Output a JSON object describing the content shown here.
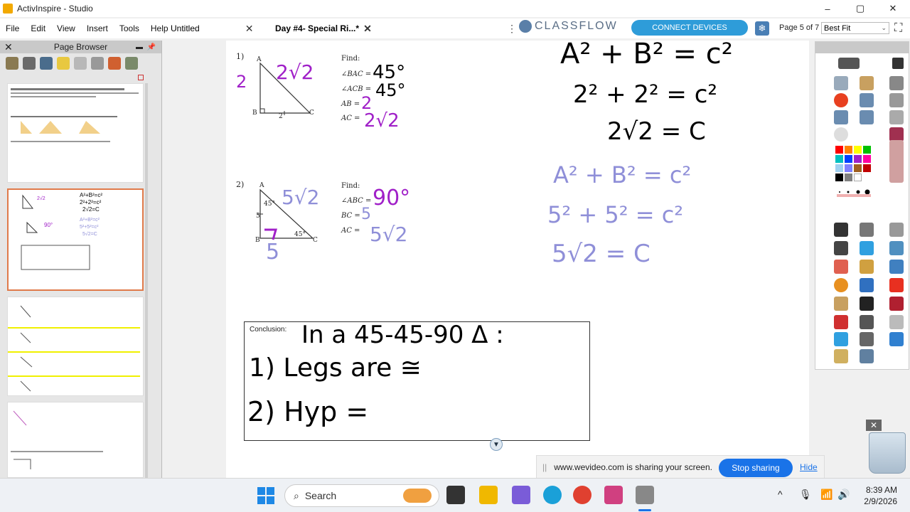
{
  "window": {
    "title": "ActivInspire - Studio",
    "minimize": "‒",
    "maximize": "▢",
    "close": "✕"
  },
  "menu": [
    "File",
    "Edit",
    "View",
    "Insert",
    "Tools",
    "Help"
  ],
  "tabs": [
    {
      "label": "Untitled",
      "close": "✕"
    },
    {
      "label": "Day #4- Special Ri...*",
      "close": "✕"
    }
  ],
  "toolbar": {
    "more": "⋮",
    "classflow": "CLASSFLOW",
    "connect_devices": "CONNECT DEVICES",
    "page_indicator": "Page 5 of 7",
    "zoom": "Best Fit",
    "zoom_arrow": "⌄",
    "expand": "⛶",
    "snowflake": "❄"
  },
  "page_browser": {
    "title": "Page Browser",
    "close": "✕",
    "pin": "▬",
    "pin2": "📌"
  },
  "problem1": {
    "number": "1)",
    "vertex_a": "A",
    "vertex_b": "B",
    "vertex_c": "C",
    "leg_bottom": "2",
    "handwritten_side": "2",
    "handwritten_hyp": "2√2",
    "find_label": "Find:",
    "items": [
      {
        "label": "∠BAC =",
        "answer": "45°"
      },
      {
        "label": "∠ACB =",
        "answer": "45°"
      },
      {
        "label": "AB =",
        "answer": "2"
      },
      {
        "label": "AC =",
        "answer": "2√2"
      }
    ]
  },
  "problem2": {
    "number": "2)",
    "vertex_a": "A",
    "vertex_b": "B",
    "vertex_c": "C",
    "angle_a": "45°",
    "angle_c": "45°",
    "leg_side": "5",
    "handwritten_hyp": "5√2",
    "handwritten_bottom": "5",
    "find_label": "Find:",
    "items": [
      {
        "label": "∠ABC =",
        "answer": "90°"
      },
      {
        "label": "BC =",
        "answer": "5"
      },
      {
        "label": "AC =",
        "answer": "5√2"
      }
    ]
  },
  "board_black": [
    "A² + B² = c²",
    "2² + 2² = c²",
    "2√2 = C"
  ],
  "board_purple": [
    "A² + B² = c²",
    "5² + 5² = c²",
    "5√2 = C"
  ],
  "conclusion": {
    "label": "Conclusion:",
    "heading": "In a 45-45-90 Δ :",
    "line1": "1) Legs are ≅",
    "line2": "2) Hyp ="
  },
  "share_bar": {
    "grip": "||",
    "message": "www.wevideo.com is sharing your screen.",
    "stop": "Stop sharing",
    "hide": "Hide"
  },
  "taskbar": {
    "search_placeholder": "Search",
    "time": "8:39 AM",
    "date": "2/9/2026",
    "tray_up": "^",
    "mic": "🎙",
    "wifi": "📶",
    "volume": "🔊"
  },
  "trash": {
    "close": "✕"
  },
  "scroll_down": "▼",
  "colors": {
    "purple": "#a020c8",
    "lavender": "#8f8fd8",
    "accent_blue": "#2e9cd9",
    "selection": "#e07a4a"
  }
}
